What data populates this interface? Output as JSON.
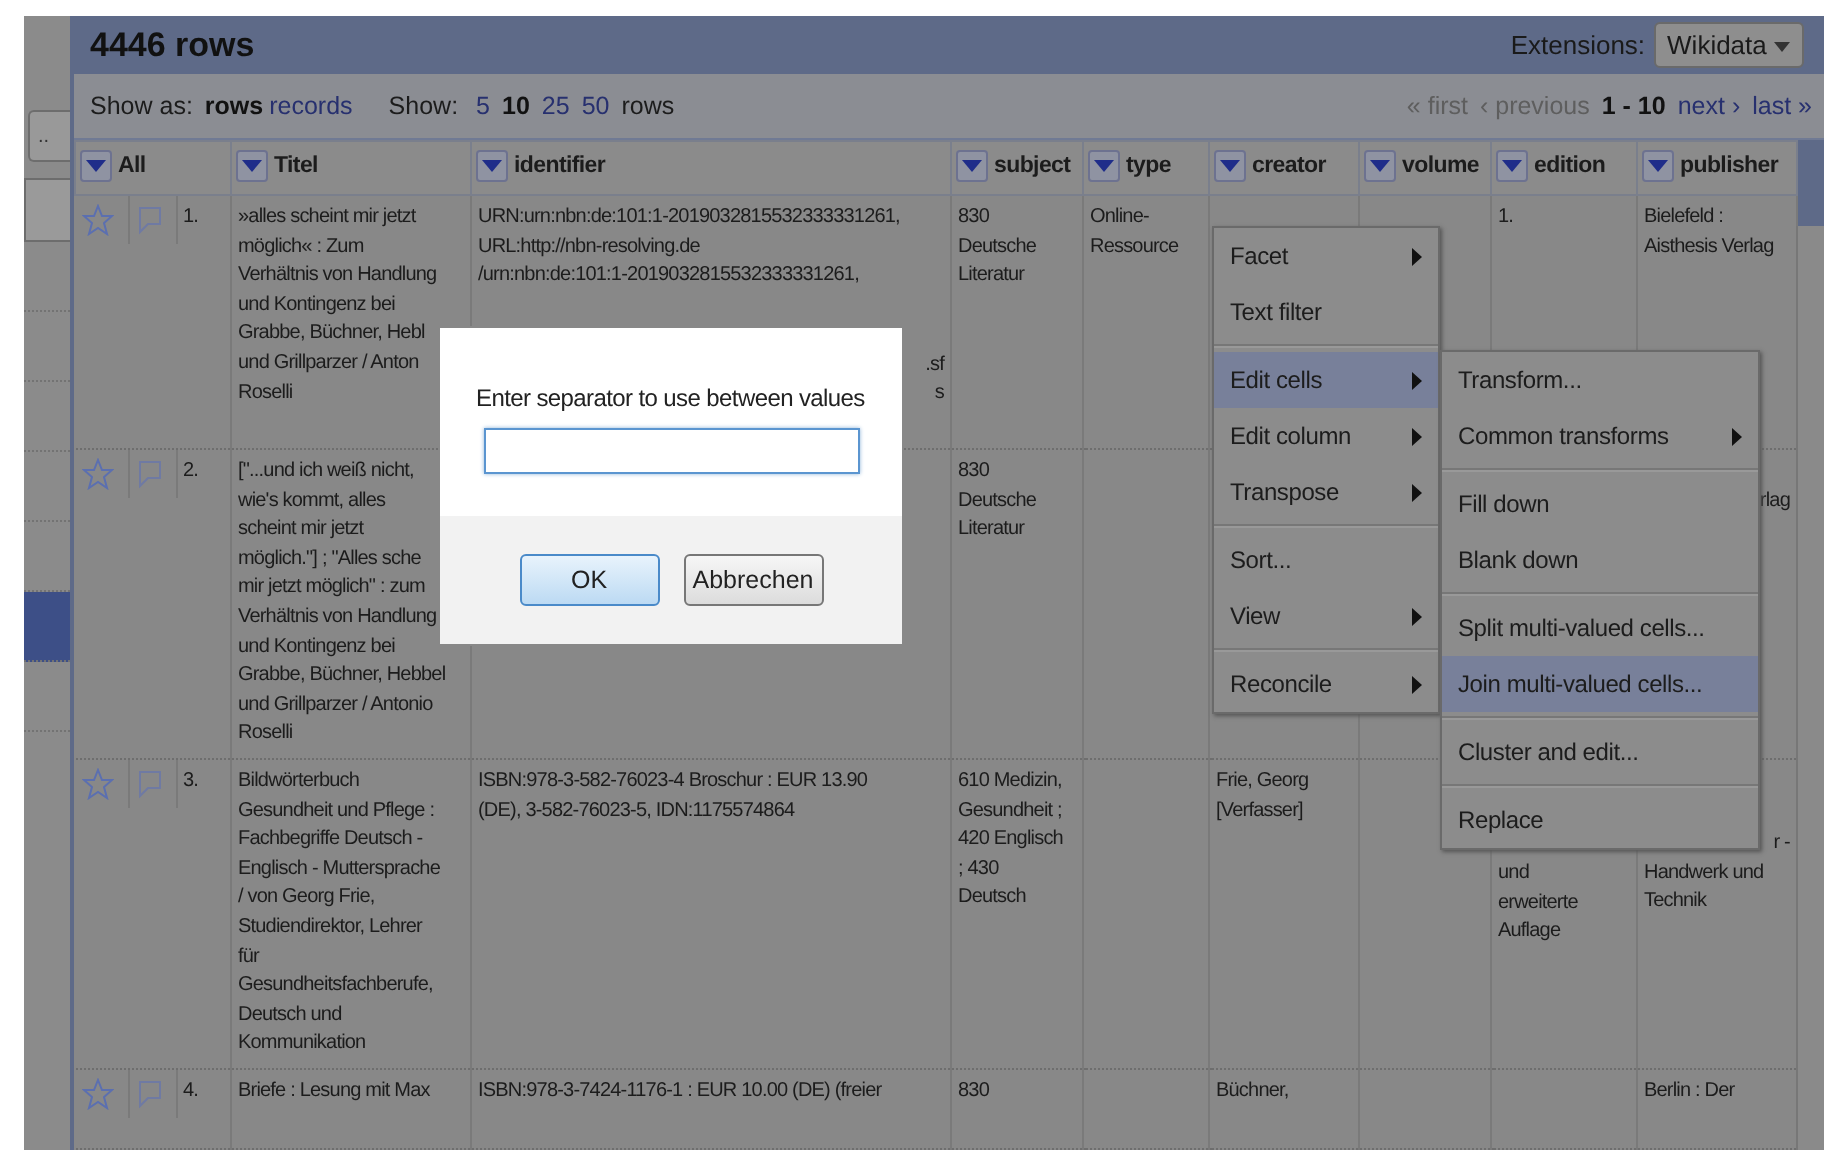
{
  "header": {
    "title": "4446 rows",
    "extensions_label": "Extensions:",
    "extensions_button": "Wikidata"
  },
  "show_bar": {
    "show_as_label": "Show as:",
    "modes": [
      {
        "label": "rows",
        "selected": true
      },
      {
        "label": "records",
        "selected": false
      }
    ],
    "show_label": "Show:",
    "sizes": [
      {
        "label": "5",
        "selected": false
      },
      {
        "label": "10",
        "selected": true
      },
      {
        "label": "25",
        "selected": false
      },
      {
        "label": "50",
        "selected": false
      }
    ],
    "rows_label": "rows"
  },
  "pager": [
    {
      "kind": "link",
      "label": "« first",
      "disabled": true
    },
    {
      "kind": "link",
      "label": "‹ previous",
      "disabled": true
    },
    {
      "kind": "range",
      "label": "1 - 10"
    },
    {
      "kind": "link",
      "label": "next ›",
      "disabled": false
    },
    {
      "kind": "link",
      "label": "last »",
      "disabled": false
    }
  ],
  "sidebar": {
    "button": "..",
    "rows": [
      {
        "selected": false
      },
      {
        "selected": false
      },
      {
        "selected": false
      },
      {
        "selected": false
      },
      {
        "selected": false
      },
      {
        "selected": true
      },
      {
        "selected": false
      }
    ]
  },
  "table": {
    "columns": [
      {
        "label": "All"
      },
      {
        "label": "Titel"
      },
      {
        "label": "identifier"
      },
      {
        "label": "subject"
      },
      {
        "label": "type"
      },
      {
        "label": "creator"
      },
      {
        "label": "volume"
      },
      {
        "label": "edition"
      },
      {
        "label": "publisher"
      }
    ],
    "rows": [
      {
        "cells": [
          {
            "kind": "row_head",
            "starred": false,
            "flagged": false,
            "number": "1."
          },
          "»alles scheint mir jetzt\nmöglich« : Zum\nVerhältnis von Handlung\nund Kontingenz bei\nGrabbe, Büchner, Hebl\nund Grillparzer / Anton\nRoselli",
          {
            "kind": "split",
            "text": "URN:urn:nbn:de:101:1-2019032815532333331261,\nURL:http://nbn-resolving.de\n/urn:nbn:de:101:1-2019032815532333331261,",
            "tail": ".sf\ns"
          },
          "830\nDeutsche\nLiteratur",
          "Online-\nRessource",
          null,
          null,
          "1.",
          "Bielefeld :\nAisthesis Verlag"
        ]
      },
      {
        "cells": [
          {
            "kind": "row_head",
            "starred": false,
            "flagged": false,
            "number": "2."
          },
          "[\"...und ich weiß nicht,\nwie's kommt, alles\nscheint mir jetzt\nmöglich.\"] ; \"Alles sche\nmir jetzt möglich\" : zum\nVerhältnis von Handlung\nund Kontingenz bei\nGrabbe, Büchner, Hebbel\nund Grillparzer / Antonio\nRoselli",
          null,
          "830\nDeutsche\nLiteratur",
          null,
          null,
          null,
          null,
          {
            "kind": "tail",
            "tail": "rlag"
          }
        ]
      },
      {
        "cells": [
          {
            "kind": "row_head",
            "starred": false,
            "flagged": false,
            "number": "3."
          },
          "Bildwörterbuch\nGesundheit und Pflege :\nFachbegriffe Deutsch -\nEnglisch - Muttersprache\n/ von Georg Frie,\nStudiendirektor, Lehrer\nfür\nGesundheitsfachberufe,\nDeutsch und\nKommunikation",
          "ISBN:978-3-582-76023-4 Broschur : EUR 13.90\n(DE), 3-582-76023-5, IDN:1175574864",
          "610 Medizin,\nGesundheit ;\n420 Englisch\n; 430\nDeutsch",
          null,
          "Frie, Georg\n[Verfasser]",
          null,
          {
            "kind": "below",
            "text": "und\nerweiterte\nAuflage"
          },
          {
            "kind": "tailtop",
            "tail": "r -",
            "text": "Handwerk und\nTechnik"
          }
        ]
      },
      {
        "cells": [
          {
            "kind": "row_head",
            "starred": false,
            "flagged": false,
            "number": "4."
          },
          "Briefe : Lesung mit Max",
          "ISBN:978-3-7424-1176-1 : EUR 10.00 (DE) (freier",
          "830",
          null,
          "Büchner,",
          null,
          null,
          "Berlin : Der"
        ]
      }
    ]
  },
  "column_menu": [
    {
      "kind": "item",
      "label": "Facet",
      "submenu": true,
      "selected": false
    },
    {
      "kind": "item",
      "label": "Text filter",
      "submenu": false,
      "selected": false
    },
    {
      "kind": "divider"
    },
    {
      "kind": "item",
      "label": "Edit cells",
      "submenu": true,
      "selected": true
    },
    {
      "kind": "item",
      "label": "Edit column",
      "submenu": true,
      "selected": false
    },
    {
      "kind": "item",
      "label": "Transpose",
      "submenu": true,
      "selected": false
    },
    {
      "kind": "divider"
    },
    {
      "kind": "item",
      "label": "Sort...",
      "submenu": false,
      "selected": false
    },
    {
      "kind": "item",
      "label": "View",
      "submenu": true,
      "selected": false
    },
    {
      "kind": "divider"
    },
    {
      "kind": "item",
      "label": "Reconcile",
      "submenu": true,
      "selected": false
    }
  ],
  "submenu": [
    {
      "kind": "item",
      "label": "Transform...",
      "submenu": false,
      "selected": false
    },
    {
      "kind": "item",
      "label": "Common transforms",
      "submenu": true,
      "selected": false
    },
    {
      "kind": "divider"
    },
    {
      "kind": "item",
      "label": "Fill down",
      "submenu": false,
      "selected": false
    },
    {
      "kind": "item",
      "label": "Blank down",
      "submenu": false,
      "selected": false
    },
    {
      "kind": "divider"
    },
    {
      "kind": "item",
      "label": "Split multi-valued cells...",
      "submenu": false,
      "selected": false
    },
    {
      "kind": "item",
      "label": "Join multi-valued cells...",
      "submenu": false,
      "selected": true
    },
    {
      "kind": "divider"
    },
    {
      "kind": "item",
      "label": "Cluster and edit...",
      "submenu": false,
      "selected": false
    },
    {
      "kind": "divider"
    },
    {
      "kind": "item",
      "label": "Replace",
      "submenu": false,
      "selected": false
    }
  ],
  "dialog": {
    "prompt": "Enter separator to use between values",
    "field": {
      "focused": true
    },
    "buttons": [
      {
        "label": "OK",
        "default": true
      },
      {
        "label": "Abbrechen",
        "default": false
      }
    ]
  }
}
